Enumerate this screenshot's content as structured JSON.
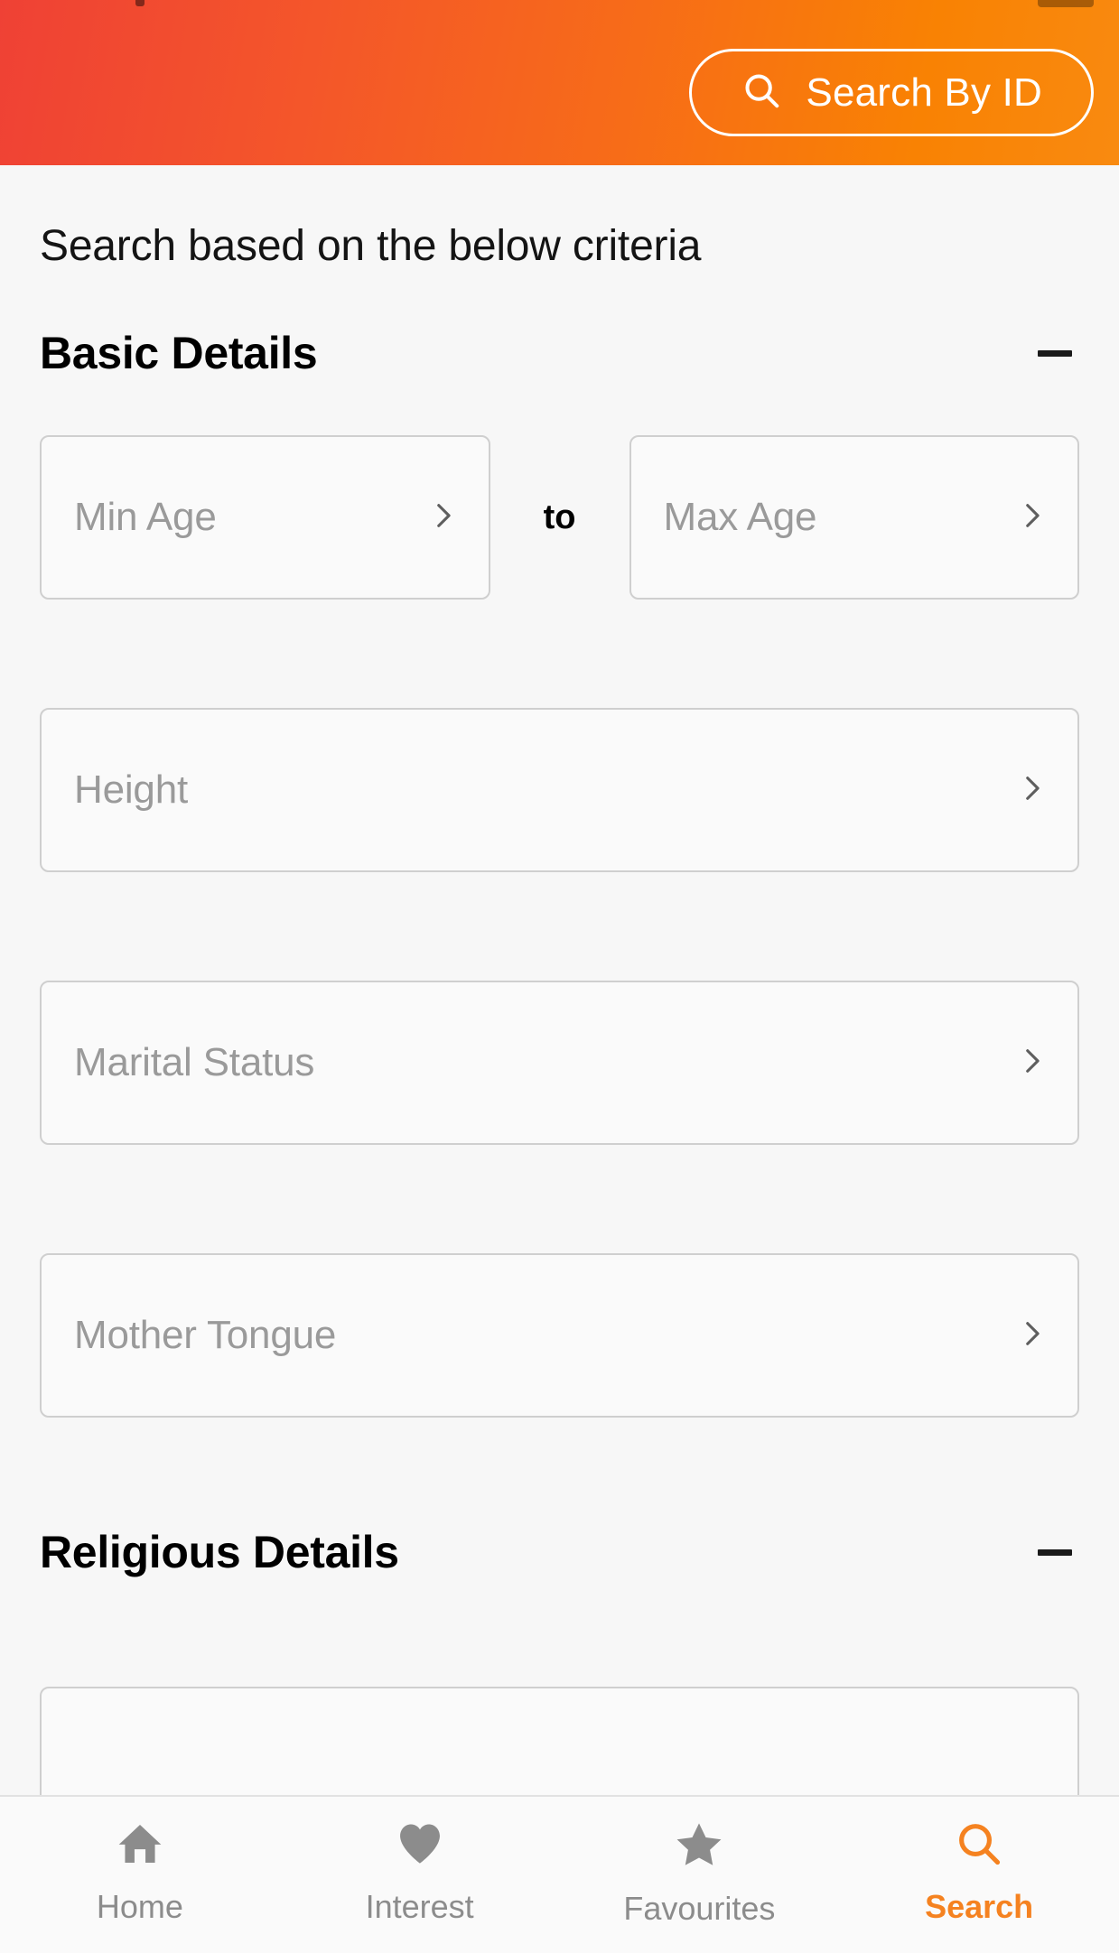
{
  "theme": {
    "gradient_start": "#EF4135",
    "gradient_end": "#F98A10",
    "accent": "#F58220",
    "page_bg": "#F7F7F7",
    "field_border": "#CFCFCF",
    "placeholder": "#9A9A9A",
    "nav_inactive": "#8C8C8C"
  },
  "header": {
    "search_by_id_label": "Search By ID",
    "search_icon": "search-icon"
  },
  "main": {
    "criteria_note": "Search based on the below criteria",
    "sections": [
      {
        "title": "Basic Details",
        "collapse_icon": "minus-icon",
        "fields": [
          {
            "placeholder": "Min Age",
            "value": "",
            "chevron": "chevron-right-icon"
          },
          {
            "placeholder": "Max Age",
            "value": "",
            "chevron": "chevron-right-icon"
          },
          {
            "placeholder": "Height",
            "value": "",
            "chevron": "chevron-right-icon"
          },
          {
            "placeholder": "Marital Status",
            "value": "",
            "chevron": "chevron-right-icon"
          },
          {
            "placeholder": "Mother Tongue",
            "value": "",
            "chevron": "chevron-right-icon"
          }
        ],
        "range_separator": "to"
      },
      {
        "title": "Religious Details",
        "collapse_icon": "minus-icon",
        "fields": [
          {
            "placeholder": "",
            "value": "",
            "chevron": "chevron-right-icon"
          }
        ]
      }
    ]
  },
  "bottom_nav": {
    "items": [
      {
        "label": "Home",
        "icon": "home-icon",
        "active": false
      },
      {
        "label": "Interest",
        "icon": "heart-icon",
        "active": false
      },
      {
        "label": "Favourites",
        "icon": "star-icon",
        "active": false
      },
      {
        "label": "Search",
        "icon": "search-icon",
        "active": true
      }
    ]
  }
}
